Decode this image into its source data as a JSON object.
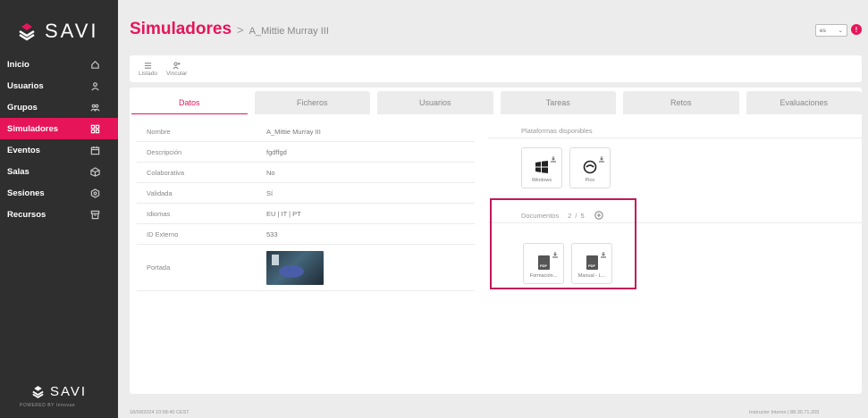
{
  "brand": {
    "name": "SAVI",
    "powered": "POWERED BY Innovae"
  },
  "sidebar": {
    "items": [
      {
        "label": "Inicio",
        "icon": "home-icon"
      },
      {
        "label": "Usuarios",
        "icon": "user-icon"
      },
      {
        "label": "Grupos",
        "icon": "group-icon"
      },
      {
        "label": "Simuladores",
        "icon": "grid-icon",
        "active": true
      },
      {
        "label": "Eventos",
        "icon": "calendar-icon"
      },
      {
        "label": "Salas",
        "icon": "room-icon"
      },
      {
        "label": "Sesiones",
        "icon": "session-icon"
      },
      {
        "label": "Recursos",
        "icon": "archive-icon"
      }
    ]
  },
  "header": {
    "title": "Simuladores",
    "separator": ">",
    "subtitle": "A_Mittie Murray III",
    "lang": "es",
    "notifications": "!"
  },
  "toolbar": {
    "list_label": "Listado",
    "link_label": "Vincular"
  },
  "tabs": [
    "Datos",
    "Ficheros",
    "Usuarios",
    "Tareas",
    "Retos",
    "Evaluaciones"
  ],
  "fields": [
    {
      "label": "Nombre",
      "value": "A_Mittie Murray III"
    },
    {
      "label": "Descripción",
      "value": "fgdffgd"
    },
    {
      "label": "Colaborativa",
      "value": "No"
    },
    {
      "label": "Validada",
      "value": "Sí"
    },
    {
      "label": "Idiomas",
      "value": "EU | IT | PT"
    },
    {
      "label": "ID Externo",
      "value": "533"
    },
    {
      "label": "Portada",
      "value": ""
    }
  ],
  "platforms": {
    "title": "Plataformas disponibles",
    "items": [
      "Windows",
      "Pico"
    ]
  },
  "documents": {
    "title": "Documentos",
    "count": "2 / 5",
    "items": [
      "Formación...",
      "Manual - L..."
    ]
  },
  "footer": {
    "datetime": "18/09/2024 10:58:40 CEST",
    "user": "Instructor Interno | 88.30.71.209"
  }
}
